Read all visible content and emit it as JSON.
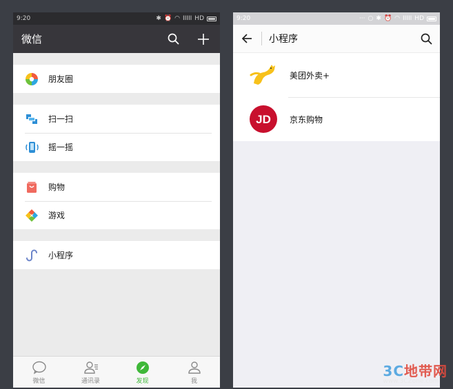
{
  "left_screen": {
    "status": {
      "time": "9:20",
      "net": "HD"
    },
    "header": {
      "title": "微信"
    },
    "groups": [
      {
        "items": [
          {
            "label": "朋友圈",
            "icon": "moments-icon"
          }
        ]
      },
      {
        "items": [
          {
            "label": "扫一扫",
            "icon": "scan-icon"
          },
          {
            "label": "摇一摇",
            "icon": "shake-icon"
          }
        ]
      },
      {
        "items": [
          {
            "label": "购物",
            "icon": "shopping-icon"
          },
          {
            "label": "游戏",
            "icon": "game-icon"
          }
        ]
      },
      {
        "items": [
          {
            "label": "小程序",
            "icon": "mini-program-icon"
          }
        ]
      }
    ],
    "tabs": [
      {
        "label": "微信",
        "icon": "chat-bubble-icon"
      },
      {
        "label": "通讯录",
        "icon": "contacts-icon"
      },
      {
        "label": "发现",
        "icon": "discover-compass-icon"
      },
      {
        "label": "我",
        "icon": "profile-icon"
      }
    ]
  },
  "right_screen": {
    "status": {
      "time": "9:20",
      "net": "HD"
    },
    "header": {
      "title": "小程序"
    },
    "items": [
      {
        "label": "美团外卖+",
        "icon": "meituan-kangaroo-icon"
      },
      {
        "label": "京东购物",
        "icon": "jd-logo-icon",
        "logo_text": "JD"
      }
    ]
  },
  "watermark": {
    "brand_a": "3C",
    "brand_b": "地带网",
    "url": "www.3CZone.com"
  },
  "colors": {
    "accent": "#3fb839",
    "title_bar": "#37363b",
    "jd_red": "#c8102e",
    "meituan_yellow": "#f7c11b"
  }
}
